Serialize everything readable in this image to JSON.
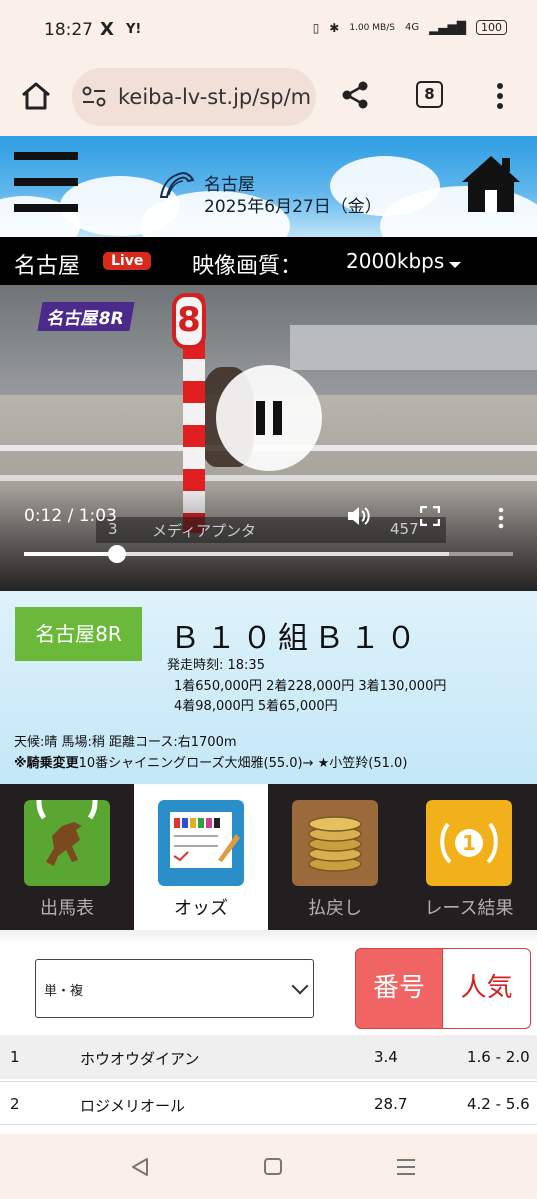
{
  "status": {
    "time": "18:27",
    "x_icon": "X",
    "yahoo_icon": "Y!",
    "speed": "1.00 MB/S",
    "net": "4G",
    "battery": "100"
  },
  "browser": {
    "url": "keiba-lv-st.jp/sp/m",
    "tab_count": "8"
  },
  "banner": {
    "title": "名古屋",
    "date": "2025年6月27日（金）"
  },
  "stream": {
    "venue": "名古屋",
    "live_badge": "Live",
    "quality_label": "映像画質：",
    "quality_value": "2000kbps"
  },
  "video": {
    "race_tag": "名古屋8R",
    "post_number": "8",
    "current_time": "0:12",
    "duration": "1:03",
    "time_display": "0:12 / 1:03",
    "played_fraction": 0.19,
    "buffered_fraction": 0.87,
    "caption_number": "3",
    "caption_name": "メディアプンタ",
    "caption_weight": "457"
  },
  "race": {
    "badge": "名古屋8R",
    "name": "Ｂ１０組Ｂ１０",
    "start_time": "発走時刻: 18:35",
    "prize_line1": "1着650,000円  2着228,000円  3着130,000円",
    "prize_line2": "4着98,000円  5着65,000円",
    "conditions": "天候:晴 馬場:稍  距離コース:右1700m",
    "change_label": "※騎乗変更",
    "change_detail": "10番シャイニングローズ大畑雅(55.0)→ ★小笠羚(51.0)"
  },
  "menu": {
    "items": [
      {
        "label": "出馬表",
        "icon": "horse-icon",
        "active": false
      },
      {
        "label": "オッズ",
        "icon": "odds-sheet-icon",
        "active": true
      },
      {
        "label": "払戻し",
        "icon": "coins-icon",
        "active": false
      },
      {
        "label": "レース結果",
        "icon": "trophy-icon",
        "active": false
      }
    ]
  },
  "odds": {
    "bet_type": "単・複",
    "sort_number_label": "番号",
    "sort_popular_label": "人気",
    "rows": [
      {
        "no": "1",
        "name": "ホウオウダイアン",
        "win": "3.4",
        "place": "1.6 - 2.0"
      },
      {
        "no": "2",
        "name": "ロジメリオール",
        "win": "28.7",
        "place": "4.2 - 5.6"
      }
    ]
  },
  "colors": {
    "accent_green": "#6ab93b",
    "live_red": "#d72a1a",
    "sort_red": "#f06464",
    "menu_bg": "#231f20"
  }
}
